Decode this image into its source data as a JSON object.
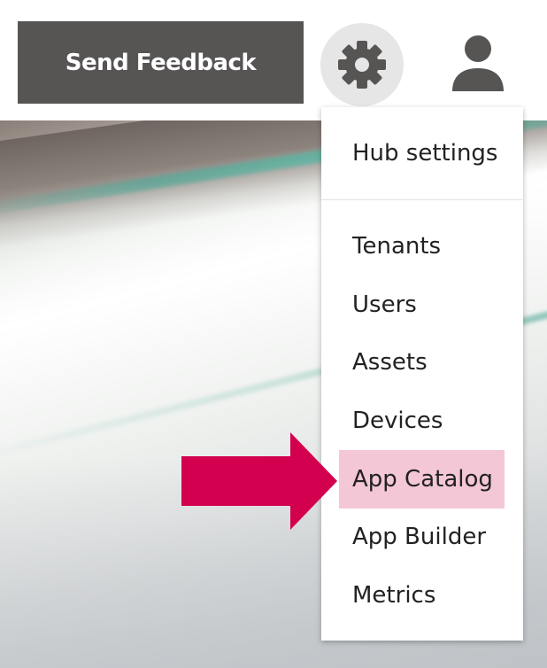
{
  "header": {
    "feedback_label": "Send Feedback",
    "settings_icon": "gear-icon",
    "user_icon": "user-icon"
  },
  "settings_menu": {
    "items": [
      {
        "label": "Hub settings"
      },
      {
        "label": "Tenants"
      },
      {
        "label": "Users"
      },
      {
        "label": "Assets"
      },
      {
        "label": "Devices"
      },
      {
        "label": "App Catalog",
        "highlighted": true
      },
      {
        "label": "App Builder"
      },
      {
        "label": "Metrics"
      }
    ]
  },
  "annotation": {
    "arrow_icon": "arrow-right-icon",
    "arrow_color": "#d3004f",
    "highlight_color": "#f4c7d6"
  },
  "colors": {
    "feedback_bg": "#575454",
    "gear_bg": "#e6e6e6",
    "icon_color": "#575454"
  }
}
